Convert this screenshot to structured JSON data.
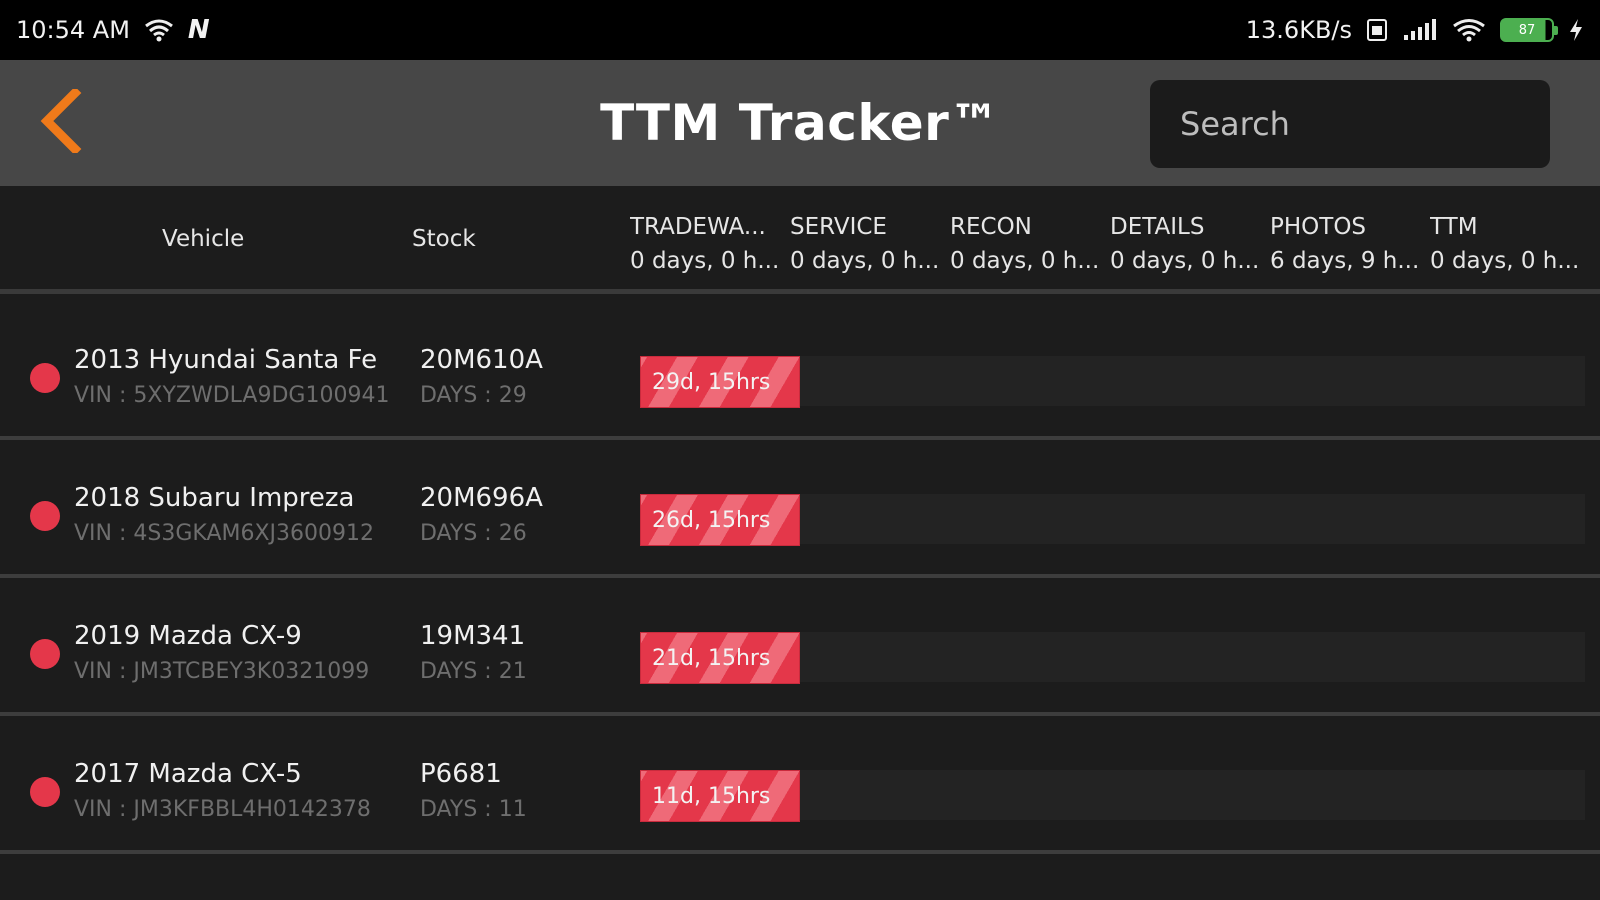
{
  "status_bar": {
    "time": "10:54 AM",
    "notification_letter": "N",
    "net_speed": "13.6KB/s",
    "battery_level": "87",
    "icons": [
      "wifi-icon",
      "n-app-icon",
      "sim-icon",
      "signal-icon",
      "wifi-icon",
      "battery-icon",
      "charging-icon"
    ]
  },
  "appbar": {
    "title": "TTM Tracker™",
    "search_placeholder": "Search",
    "back_icon": "chevron-left-icon",
    "accent_color": "#f07a1a"
  },
  "header": {
    "vehicle_label": "Vehicle",
    "stock_label": "Stock",
    "stages": [
      {
        "name": "TRADEWA...",
        "duration": "0 days, 0 h..."
      },
      {
        "name": "SERVICE",
        "duration": "0 days, 0 h..."
      },
      {
        "name": "RECON",
        "duration": "0 days, 0 h..."
      },
      {
        "name": "DETAILS",
        "duration": "0 days, 0 h..."
      },
      {
        "name": "PHOTOS",
        "duration": "6 days, 9 h..."
      },
      {
        "name": "TTM",
        "duration": "0 days, 0 h..."
      }
    ]
  },
  "vehicles": [
    {
      "name": "2013 Hyundai Santa Fe",
      "vin": "VIN : 5XYZWDLA9DG100941",
      "stock": "20M610A",
      "days": "DAYS : 29",
      "bar_label": "29d, 15hrs",
      "status_color": "#e4374a"
    },
    {
      "name": "2018 Subaru Impreza",
      "vin": "VIN : 4S3GKAM6XJ3600912",
      "stock": "20M696A",
      "days": "DAYS : 26",
      "bar_label": "26d, 15hrs",
      "status_color": "#e4374a"
    },
    {
      "name": "2019 Mazda CX-9",
      "vin": "VIN : JM3TCBEY3K0321099",
      "stock": "19M341",
      "days": "DAYS : 21",
      "bar_label": "21d, 15hrs",
      "status_color": "#e4374a"
    },
    {
      "name": "2017 Mazda CX-5",
      "vin": "VIN : JM3KFBBL4H0142378",
      "stock": "P6681",
      "days": "DAYS : 11",
      "bar_label": "11d, 15hrs",
      "status_color": "#e4374a"
    }
  ]
}
